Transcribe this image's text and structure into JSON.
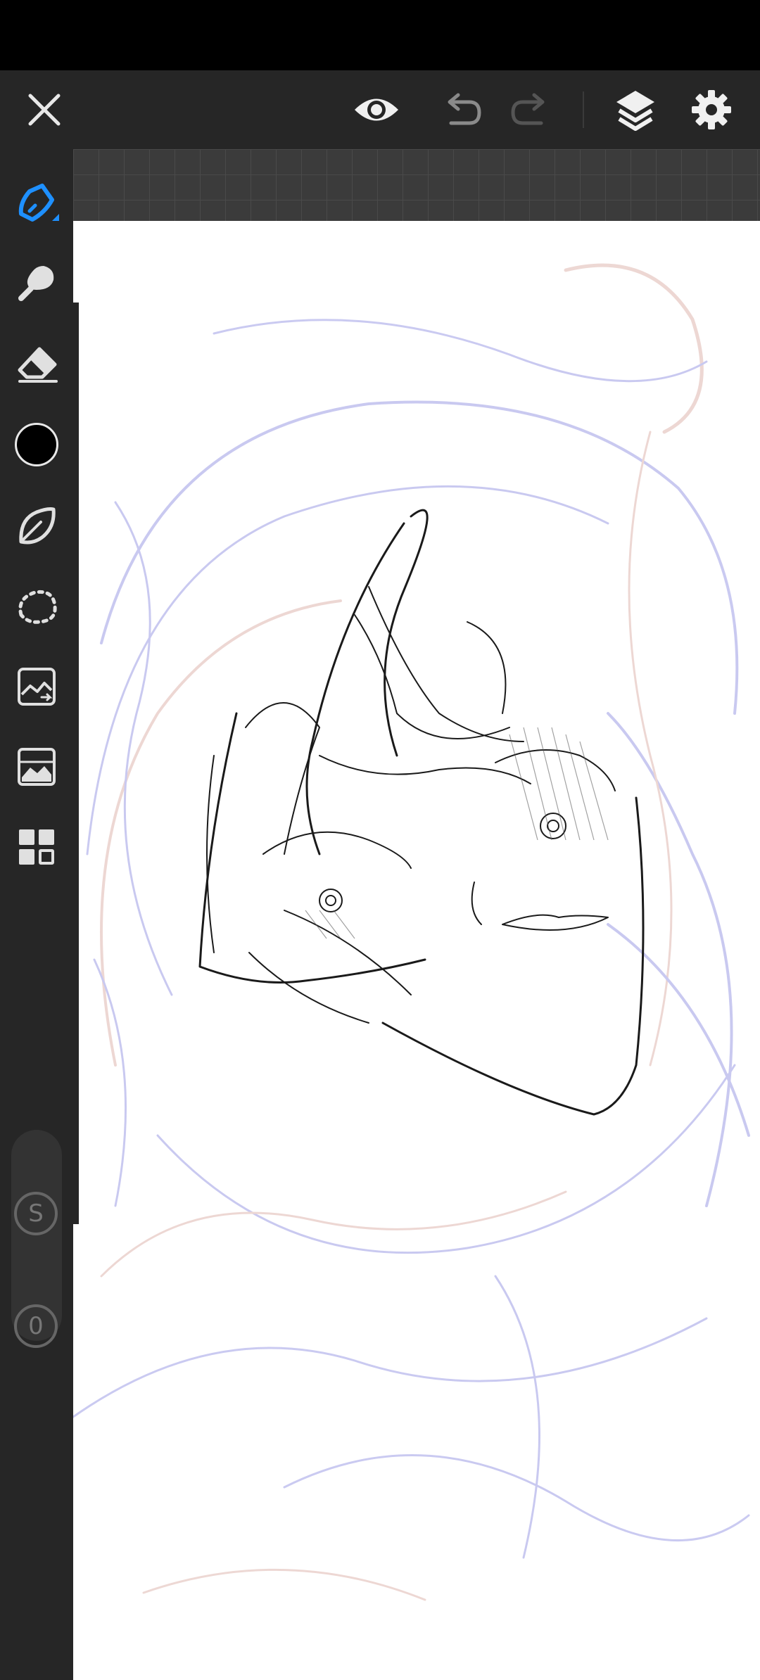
{
  "app": {
    "toolbar": {
      "close_icon": "close-icon",
      "preview_icon": "eye-icon",
      "undo_icon": "undo-icon",
      "redo_icon": "redo-icon",
      "layers_icon": "layers-icon",
      "settings_icon": "gear-icon"
    },
    "tools": [
      {
        "name": "pen-tool",
        "icon": "pen-icon",
        "active": true
      },
      {
        "name": "smudge-tool",
        "icon": "smudge-icon"
      },
      {
        "name": "eraser-tool",
        "icon": "eraser-icon"
      },
      {
        "name": "color-swatch",
        "icon": "color-circle",
        "color": "#000000"
      },
      {
        "name": "brush-tool",
        "icon": "leaf-brush-icon"
      },
      {
        "name": "lasso-tool",
        "icon": "lasso-icon"
      },
      {
        "name": "image-import-tool",
        "icon": "image-icon"
      },
      {
        "name": "adjust-tool",
        "icon": "landscape-icon"
      },
      {
        "name": "more-tools",
        "icon": "grid-icon"
      }
    ],
    "size_button_label": "S",
    "opacity_button_label": "0",
    "colors": {
      "accent": "#1E90FF",
      "panel": "#262626",
      "ink": "#1a1a1a",
      "sketch_blue": "#8a8ae0",
      "sketch_red": "#d8a8a0"
    }
  }
}
